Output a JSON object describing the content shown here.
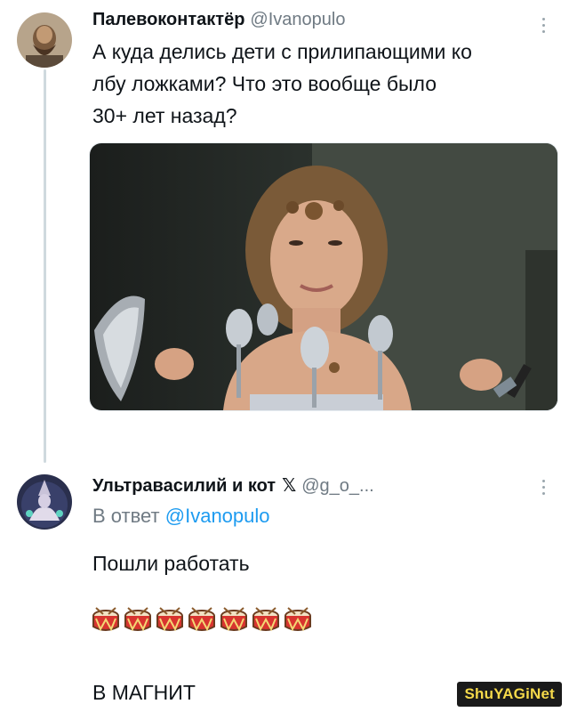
{
  "tweet1": {
    "display_name": "Палевоконтактёр",
    "handle": "@Ivanopulo",
    "text_lines": [
      "А куда делись дети с прилипающими ко",
      "лбу ложками? Что это вообще было",
      "30+ лет назад?"
    ]
  },
  "tweet2": {
    "display_name": "Ультравасилий и кот",
    "badge": "𝕏",
    "handle": "@g_o_...",
    "reply_prefix": "В ответ",
    "reply_handle": "@Ivanopulo",
    "body": "Пошли работать",
    "emoji_count": 7,
    "emoji_name": "drum",
    "footer": "В МАГНИТ"
  },
  "watermark": "ShuYAGiNet",
  "colors": {
    "text": "#0f1419",
    "secondary": "#6f7a83",
    "link": "#1d9bf0",
    "thread_line": "#cfd9de"
  }
}
